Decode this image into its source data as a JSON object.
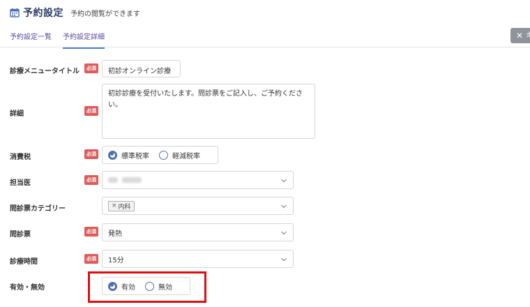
{
  "header": {
    "title": "予約設定",
    "subtitle": "予約の閲覧ができます"
  },
  "tabs": [
    {
      "label": "予約設定一覧",
      "active": false
    },
    {
      "label": "予約設定詳細",
      "active": true
    }
  ],
  "close_button": {
    "label": "✕ キ"
  },
  "required_label": "必須",
  "form": {
    "menu_title": {
      "label": "診療メニュータイトル",
      "value": "初診オンライン診療",
      "required": true
    },
    "detail": {
      "label": "詳細",
      "value": "初診診療を受付いたします。問診票をご記入し、ご予約ください。",
      "required": true
    },
    "tax": {
      "label": "消費税",
      "required": true,
      "options": [
        "標準税率",
        "軽減税率"
      ],
      "selected": "標準税率"
    },
    "doctor": {
      "label": "担当医",
      "required": true,
      "value_obscured": true
    },
    "questionnaire_category": {
      "label": "問診票カテゴリー",
      "required": false,
      "tags": [
        "内科"
      ]
    },
    "questionnaire": {
      "label": "問診票",
      "required": true,
      "value": "発熱"
    },
    "duration": {
      "label": "診療時間",
      "required": true,
      "value": "15分"
    },
    "enabled": {
      "label": "有効・無効",
      "required": false,
      "options": [
        "有効",
        "無効"
      ],
      "selected": "有効"
    }
  },
  "colors": {
    "accent": "#4f6fb5",
    "required_badge": "#e05a5a",
    "highlight_box": "#e00d0d",
    "tab_text": "#5a4a9a"
  }
}
